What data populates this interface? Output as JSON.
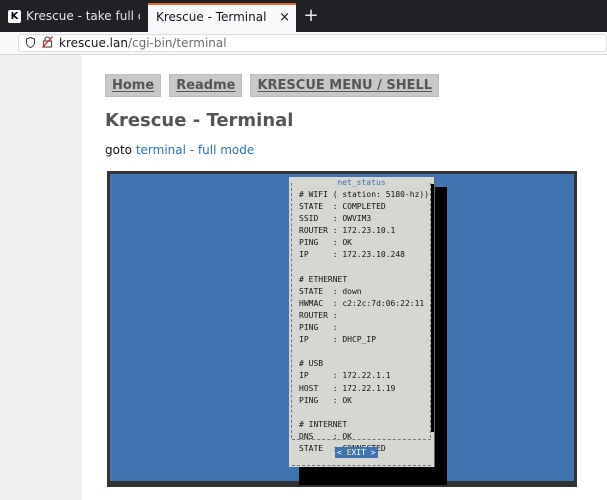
{
  "browser": {
    "tabs": [
      {
        "label": "Krescue - take full contro",
        "favicon": "K",
        "active": false
      },
      {
        "label": "Krescue - Terminal",
        "active": true
      }
    ],
    "close_glyph": "×",
    "new_tab_glyph": "+",
    "url": {
      "host": "krescue.lan",
      "path": "/cgi-bin/terminal"
    }
  },
  "nav": {
    "home": "Home",
    "readme": "Readme",
    "menu": "KRESCUE MENU / SHELL"
  },
  "page": {
    "title": "Krescue - Terminal",
    "goto_prefix": "goto",
    "goto_link": "terminal - full mode"
  },
  "terminal": {
    "dialog_title": "net_status",
    "lines": [
      "# WIFI ( station: 5180-hz))",
      "STATE  : COMPLETED",
      "SSID   : OWVIM3",
      "ROUTER : 172.23.10.1",
      "PING   : OK",
      "IP     : 172.23.10.248",
      "",
      "# ETHERNET",
      "STATE  : down",
      "HWMAC  : c2:2c:7d:06:22:11",
      "ROUTER :",
      "PING   :",
      "IP     : DHCP_IP",
      "",
      "# USB",
      "IP     : 172.22.1.1",
      "HOST   : 172.22.1.19",
      "PING   : OK",
      "",
      "# INTERNET",
      "DNS    : OK",
      "STATE  : CONNECTED"
    ],
    "exit_left": "< ",
    "exit_hotkey": "E",
    "exit_rest": "XIT >"
  }
}
